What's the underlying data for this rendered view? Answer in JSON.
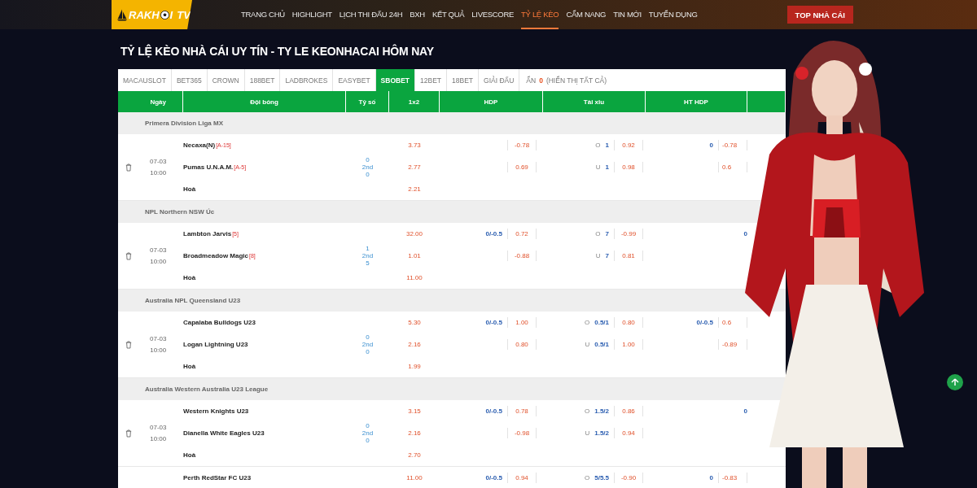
{
  "header": {
    "logo": {
      "text": "RAKH",
      "tail": "I",
      "suffix": "TV"
    },
    "nav": [
      {
        "label": "TRANG CHỦ",
        "selected": false
      },
      {
        "label": "HIGHLIGHT",
        "selected": false
      },
      {
        "label": "LỊCH THI ĐẤU 24H",
        "selected": false
      },
      {
        "label": "BXH",
        "selected": false
      },
      {
        "label": "KẾT QUẢ",
        "selected": false
      },
      {
        "label": "LIVESCORE",
        "selected": false
      },
      {
        "label": "TỶ LỆ KÈO",
        "selected": true
      },
      {
        "label": "CẨM NANG",
        "selected": false
      },
      {
        "label": "TIN MỚI",
        "selected": false
      },
      {
        "label": "TUYỂN DỤNG",
        "selected": false
      }
    ],
    "cta": "TOP NHÀ CÁI"
  },
  "title": "TỶ LỆ KÈO NHÀ CÁI UY TÍN - TY LE KEONHACAI HÔM NAY",
  "bookmaker_tabs": [
    {
      "label": "MACAUSLOT",
      "selected": false
    },
    {
      "label": "BET365",
      "selected": false
    },
    {
      "label": "CROWN",
      "selected": false
    },
    {
      "label": "188BET",
      "selected": false
    },
    {
      "label": "LADBROKES",
      "selected": false
    },
    {
      "label": "EASYBET",
      "selected": false
    },
    {
      "label": "SBOBET",
      "selected": true
    },
    {
      "label": "12BET",
      "selected": false
    },
    {
      "label": "18BET",
      "selected": false
    },
    {
      "label": "GIẢI ĐẤU",
      "selected": false
    }
  ],
  "hidden_filter": {
    "label": "ẨN",
    "count": "0",
    "link": "(HIỂN THỊ TẤT CẢ)"
  },
  "table": {
    "columns": [
      "Ngày",
      "Đội bóng",
      "Tỷ số",
      "1x2",
      "HDP",
      "Tài xỉu",
      "HT HDP"
    ],
    "leagues": [
      {
        "name": "Primera Division Liga MX",
        "matches": [
          {
            "date": "07-03",
            "time": "10:00",
            "score": [
              "0",
              "2nd",
              "0"
            ],
            "lines": [
              {
                "team": "Necaxa(N)",
                "tag": "[A-15]",
                "odds_1x2": "3.73",
                "hdp_odds": "-0.78",
                "ou_side": "O",
                "ou_line": "1",
                "ou_odds": "0.92",
                "ht_line": "0",
                "ht_odds": "-0.78"
              },
              {
                "team": "Pumas U.N.A.M.",
                "tag": "[A-5]",
                "odds_1x2": "2.77",
                "hdp_odds": "0.69",
                "ou_side": "U",
                "ou_line": "1",
                "ou_odds": "0.98",
                "ht_odds": "0.6"
              },
              {
                "team": "Hoà",
                "odds_1x2": "2.21"
              }
            ]
          }
        ]
      },
      {
        "name": "NPL Northern NSW Úc",
        "matches": [
          {
            "date": "07-03",
            "time": "10:00",
            "score": [
              "1",
              "2nd",
              "5"
            ],
            "lines": [
              {
                "team": "Lambton Jarvis",
                "tag": "[5]",
                "odds_1x2": "32.00",
                "hdp_line": "0/-0.5",
                "hdp_odds": "0.72",
                "ou_side": "O",
                "ou_line": "7",
                "ou_odds": "-0.99",
                "ht_line": "0"
              },
              {
                "team": "Broadmeadow Magic",
                "tag": "[8]",
                "odds_1x2": "1.01",
                "hdp_odds": "-0.88",
                "ou_side": "U",
                "ou_line": "7",
                "ou_odds": "0.81"
              },
              {
                "team": "Hoà",
                "odds_1x2": "11.00"
              }
            ]
          }
        ]
      },
      {
        "name": "Australia NPL Queensland U23",
        "matches": [
          {
            "date": "07-03",
            "time": "10:00",
            "score": [
              "0",
              "2nd",
              "0"
            ],
            "lines": [
              {
                "team": "Capalaba Bulldogs U23",
                "odds_1x2": "5.30",
                "hdp_line": "0/-0.5",
                "hdp_odds": "1.00",
                "ou_side": "O",
                "ou_line": "0.5/1",
                "ou_odds": "0.80",
                "ht_line": "0/-0.5",
                "ht_odds": "0.6"
              },
              {
                "team": "Logan Lightning U23",
                "odds_1x2": "2.16",
                "hdp_odds": "0.80",
                "ou_side": "U",
                "ou_line": "0.5/1",
                "ou_odds": "1.00",
                "ht_odds": "-0.89"
              },
              {
                "team": "Hoà",
                "odds_1x2": "1.99"
              }
            ]
          }
        ]
      },
      {
        "name": "Australia Western Australia U23 League",
        "matches": [
          {
            "date": "07-03",
            "time": "10:00",
            "score": [
              "0",
              "2nd",
              "0"
            ],
            "lines": [
              {
                "team": "Western Knights U23",
                "odds_1x2": "3.15",
                "hdp_line": "0/-0.5",
                "hdp_odds": "0.78",
                "ou_side": "O",
                "ou_line": "1.5/2",
                "ou_odds": "0.86",
                "ht_line": "0"
              },
              {
                "team": "Dianella White Eagles U23",
                "odds_1x2": "2.16",
                "hdp_odds": "-0.98",
                "ou_side": "U",
                "ou_line": "1.5/2",
                "ou_odds": "0.94"
              },
              {
                "team": "Hoà",
                "odds_1x2": "2.70"
              }
            ]
          },
          {
            "lines": [
              {
                "team": "Perth RedStar FC U23",
                "odds_1x2": "11.00",
                "hdp_line": "0/-0.5",
                "hdp_odds": "0.94",
                "ou_side": "O",
                "ou_line": "5/5.5",
                "ou_odds": "-0.90",
                "ht_line": "0",
                "ht_odds": "-0.83"
              }
            ]
          }
        ]
      }
    ]
  }
}
